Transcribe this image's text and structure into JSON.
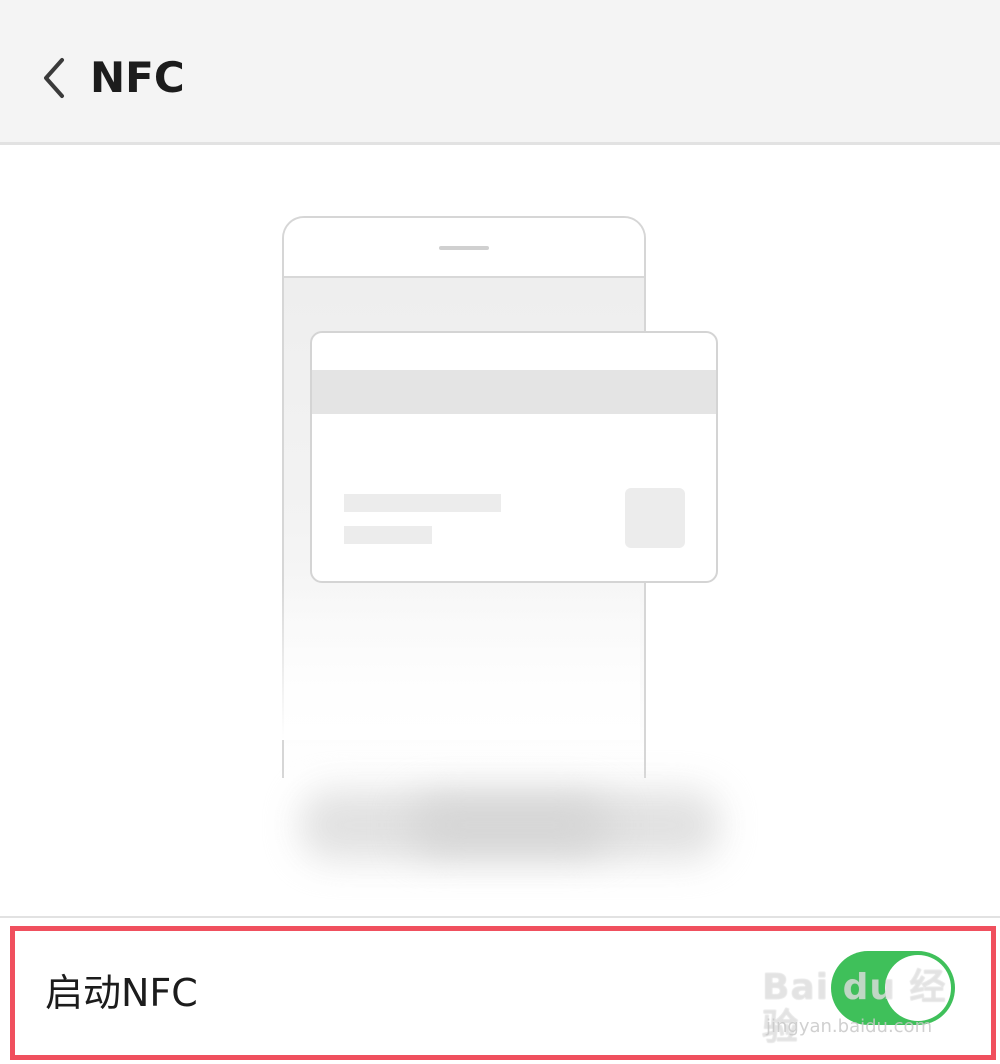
{
  "header": {
    "title": "NFC",
    "back_icon": "chevron-left-icon"
  },
  "illustration": {
    "icon": "phone-with-card-illustration"
  },
  "settings": {
    "nfc_toggle": {
      "label": "启动NFC",
      "enabled": true,
      "on_color": "#3fc05a",
      "highlight_color": "#f0505e"
    }
  },
  "watermark": {
    "main": "Bai du 经验",
    "sub": "jingyan.baidu.com"
  }
}
